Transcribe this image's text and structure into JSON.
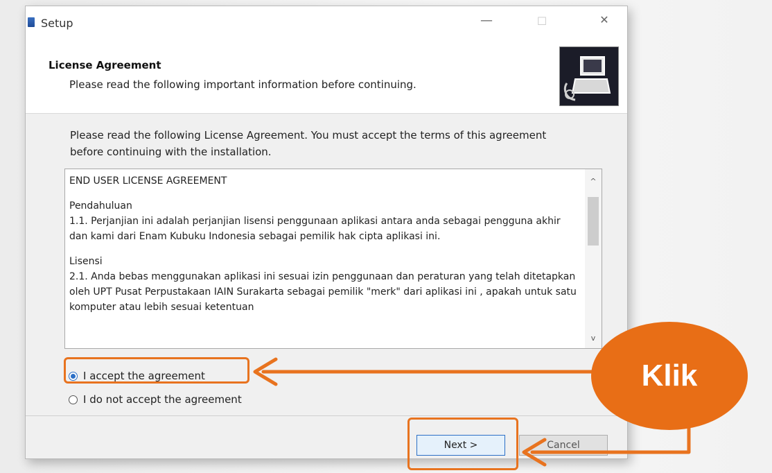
{
  "window": {
    "title": "Setup",
    "minimize": "—",
    "maximize": "☐",
    "close": "✕"
  },
  "header": {
    "title": "License Agreement",
    "subtitle": "Please read the following important information before continuing."
  },
  "intro": "Please read the following License Agreement. You must accept the terms of this agreement before continuing with the installation.",
  "license": {
    "paragraphs": [
      "END USER LICENSE AGREEMENT",
      "Pendahuluan\n1.1. Perjanjian ini adalah perjanjian lisensi penggunaan aplikasi antara anda sebagai pengguna akhir dan kami dari Enam Kubuku Indonesia sebagai pemilik hak cipta aplikasi ini.",
      "Lisensi\n2.1. Anda bebas menggunakan aplikasi ini sesuai izin penggunaan dan peraturan yang telah ditetapkan oleh UPT Pusat Perpustakaan IAIN Surakarta sebagai pemilik \"merk\" dari aplikasi ini , apakah untuk satu komputer atau lebih sesuai ketentuan"
    ],
    "scroll_up": "^",
    "scroll_down": "v"
  },
  "options": {
    "accept": "I accept the agreement",
    "reject": "I do not accept the agreement",
    "selected": "accept"
  },
  "buttons": {
    "next": "Next >",
    "cancel": "Cancel"
  },
  "annotation": {
    "callout_text": "Klik",
    "color": "#e8731f"
  }
}
